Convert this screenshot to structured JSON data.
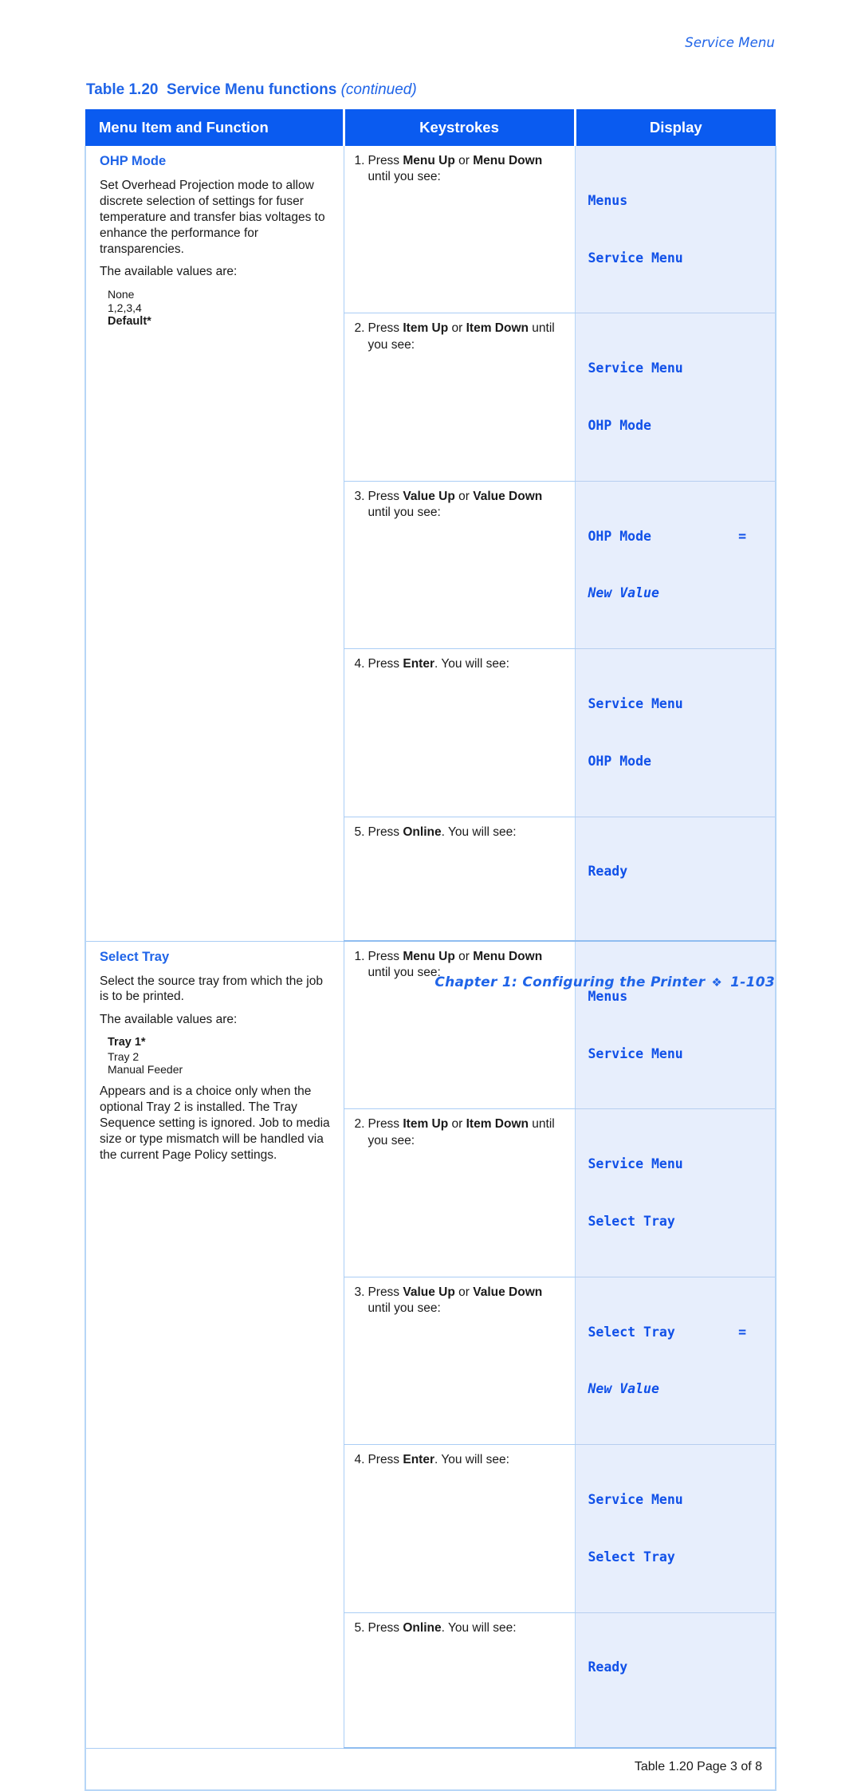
{
  "running_head": "Service Menu",
  "table_title": {
    "number": "Table 1.20",
    "name": "Service Menu functions",
    "continued": "(continued)"
  },
  "columns": {
    "menu_item": "Menu Item and Function",
    "keystrokes": "Keystrokes",
    "display": "Display"
  },
  "sections": [
    {
      "heading": "OHP Mode",
      "paragraph1": "Set Overhead Projection mode to allow discrete selection of settings for fuser temperature and transfer bias voltages to enhance the performance for transparencies.",
      "paragraph2": "The available values are:",
      "values": [
        "None",
        "1,2,3,4",
        "Default*"
      ],
      "default_value": "Default*",
      "paragraph3": "",
      "steps": [
        {
          "num": "1.",
          "text_before": "Press ",
          "key1": "Menu Up",
          "or": " or ",
          "key2": "Menu Down",
          "text_after": " until you see:",
          "display_line1": "Menus",
          "display_line2": "Service Menu",
          "display_line2_italic": false,
          "display_eq": ""
        },
        {
          "num": "2.",
          "text_before": "Press ",
          "key1": "Item Up",
          "or": " or ",
          "key2": "Item Down",
          "text_after": " until you see:",
          "display_line1": "Service Menu",
          "display_line2": "OHP Mode",
          "display_line2_italic": false,
          "display_eq": ""
        },
        {
          "num": "3.",
          "text_before": "Press ",
          "key1": "Value Up",
          "or": " or ",
          "key2": "Value Down",
          "text_after": " until you see:",
          "display_line1": "OHP Mode",
          "display_line2": "New Value",
          "display_line2_italic": true,
          "display_eq": "="
        },
        {
          "num": "4.",
          "text_before": "Press ",
          "key1": "Enter",
          "or": "",
          "key2": "",
          "text_after": ". You will see:",
          "display_line1": "Service Menu",
          "display_line2": "OHP Mode",
          "display_line2_italic": false,
          "display_eq": ""
        },
        {
          "num": "5.",
          "text_before": "Press ",
          "key1": "Online",
          "or": "",
          "key2": "",
          "text_after": ". You will see:",
          "display_line1": "Ready",
          "display_line2": "",
          "display_line2_italic": false,
          "display_eq": ""
        }
      ]
    },
    {
      "heading": "Select Tray",
      "paragraph1": "Select the source tray from which the job is to be printed.",
      "paragraph2": "The available values are:",
      "values": [
        "Tray 1*",
        "Tray 2",
        "Manual Feeder"
      ],
      "default_value": "Tray 1*",
      "paragraph3": "Appears and is a choice only when the optional Tray 2 is installed. The Tray Sequence setting is ignored. Job to media size or type mismatch will be handled via the current Page Policy settings.",
      "steps": [
        {
          "num": "1.",
          "text_before": "Press ",
          "key1": "Menu Up",
          "or": " or ",
          "key2": "Menu Down",
          "text_after": " until you see:",
          "display_line1": "Menus",
          "display_line2": "Service Menu",
          "display_line2_italic": false,
          "display_eq": ""
        },
        {
          "num": "2.",
          "text_before": "Press ",
          "key1": "Item Up",
          "or": " or ",
          "key2": "Item Down",
          "text_after": " until you see:",
          "display_line1": "Service Menu",
          "display_line2": "Select Tray",
          "display_line2_italic": false,
          "display_eq": ""
        },
        {
          "num": "3.",
          "text_before": "Press ",
          "key1": "Value Up",
          "or": " or ",
          "key2": "Value Down",
          "text_after": " until you see:",
          "display_line1": "Select Tray",
          "display_line2": "New Value",
          "display_line2_italic": true,
          "display_eq": "="
        },
        {
          "num": "4.",
          "text_before": "Press ",
          "key1": "Enter",
          "or": "",
          "key2": "",
          "text_after": ". You will see:",
          "display_line1": "Service Menu",
          "display_line2": "Select Tray",
          "display_line2_italic": false,
          "display_eq": ""
        },
        {
          "num": "5.",
          "text_before": "Press ",
          "key1": "Online",
          "or": "",
          "key2": "",
          "text_after": ". You will see:",
          "display_line1": "Ready",
          "display_line2": "",
          "display_line2_italic": false,
          "display_eq": ""
        }
      ]
    }
  ],
  "table_caption_footer": "Table 1.20  Page 3 of 8",
  "page_footer": {
    "chapter": "Chapter 1: Configuring the Printer",
    "ornament": "❖",
    "page_number": "1-103"
  },
  "colors": {
    "header_blue": "#0a5bf0",
    "accent_blue": "#1f64e8",
    "display_bg": "#e7eefc",
    "display_text": "#1050e8",
    "rule": "#aacdf5"
  }
}
